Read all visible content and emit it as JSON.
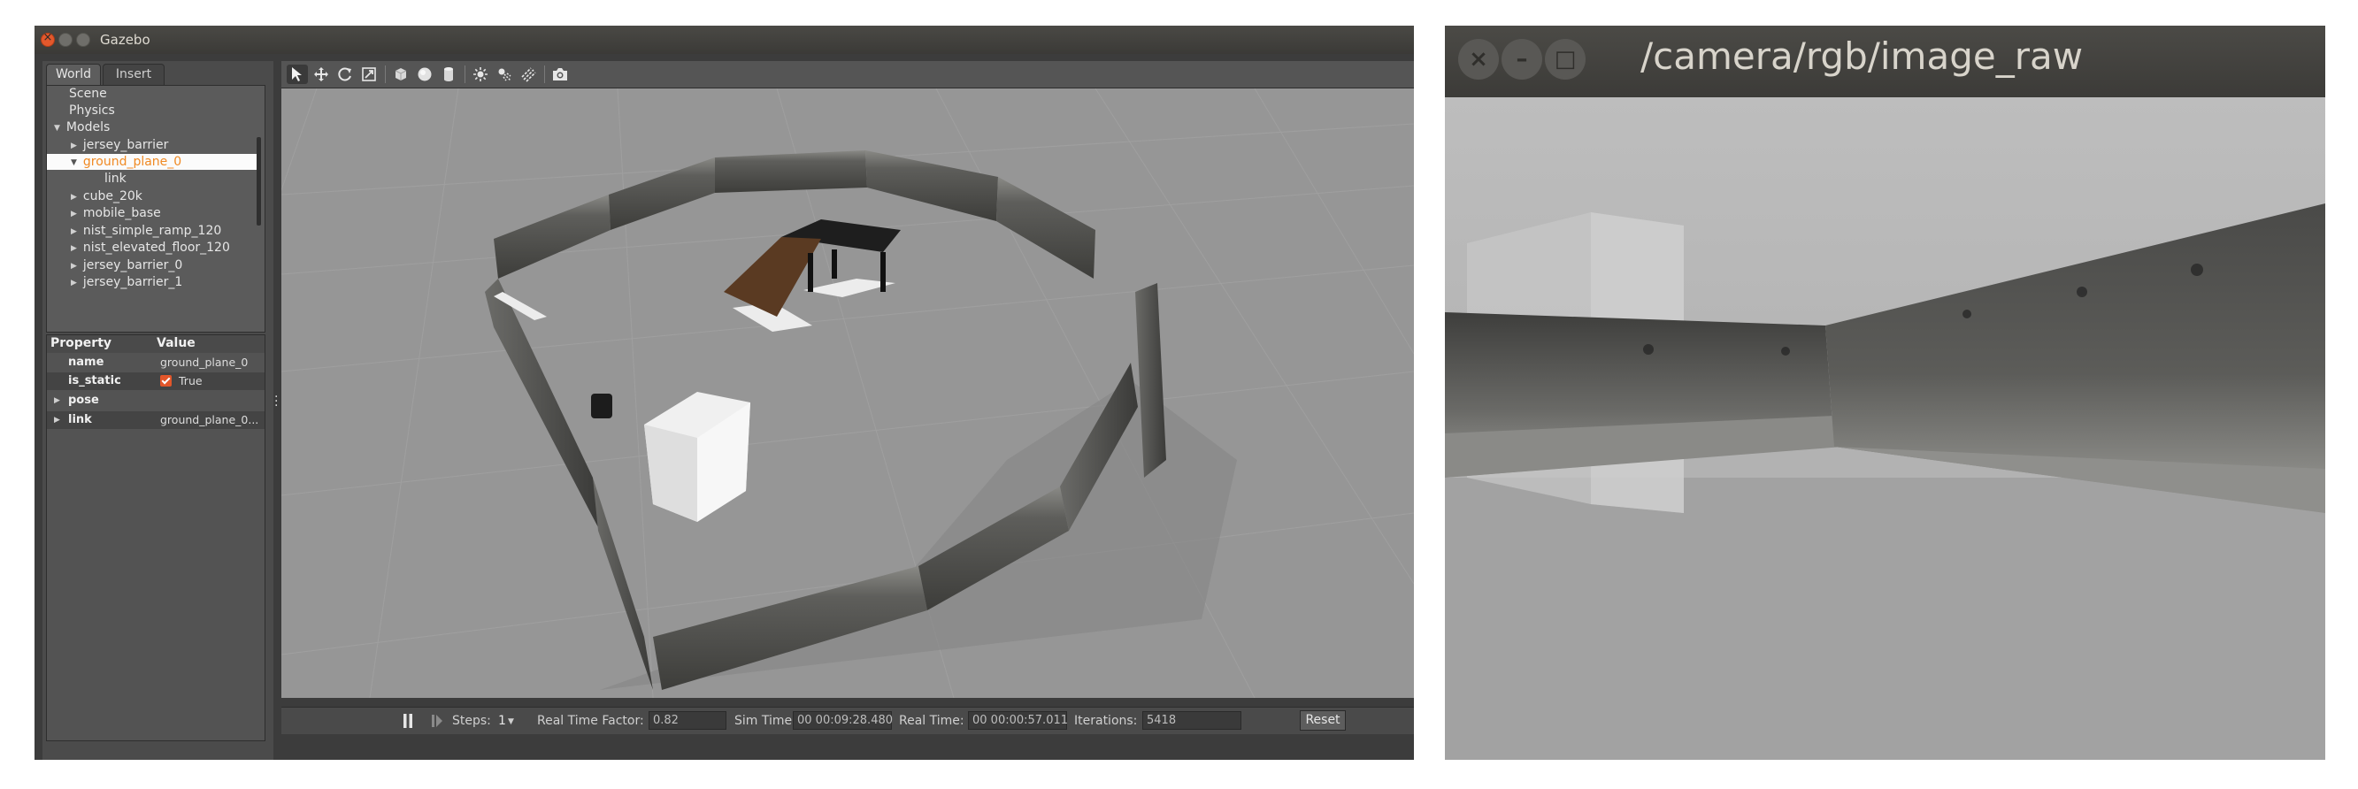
{
  "gazebo": {
    "window_title": "Gazebo",
    "close_glyph": "×",
    "tabs": {
      "world": "World",
      "insert": "Insert"
    },
    "tree": {
      "scene": "Scene",
      "physics": "Physics",
      "models": "Models",
      "models_children": [
        "jersey_barrier",
        "ground_plane_0",
        "link",
        "cube_20k",
        "mobile_base",
        "nist_simple_ramp_120",
        "nist_elevated_floor_120",
        "jersey_barrier_0",
        "jersey_barrier_1"
      ],
      "selected_item": "ground_plane_0"
    },
    "properties": {
      "header_property": "Property",
      "header_value": "Value",
      "rows": [
        {
          "key": "name",
          "value": "ground_plane_0"
        },
        {
          "key": "is_static",
          "value": "True"
        },
        {
          "key": "pose",
          "value": ""
        },
        {
          "key": "link",
          "value": "ground_plane_0..."
        }
      ]
    },
    "toolbar": {
      "tools": [
        "select-arrow-icon",
        "translate-icon",
        "rotate-icon",
        "scale-icon",
        "box-icon",
        "sphere-icon",
        "cylinder-icon",
        "point-light-icon",
        "spot-light-icon",
        "directional-light-icon",
        "screenshot-icon"
      ]
    },
    "status": {
      "steps_label": "Steps:",
      "steps_value": "1",
      "rtf_label": "Real Time Factor:",
      "rtf_value": "0.82",
      "sim_time_label": "Sim Time:",
      "sim_time_value": "00 00:09:28.480",
      "real_time_label": "Real Time:",
      "real_time_value": "00 00:00:57.011",
      "iterations_label": "Iterations:",
      "iterations_value": "5418",
      "reset_label": "Reset"
    }
  },
  "image_view": {
    "window_title": "/camera/rgb/image_raw",
    "close_glyph": "×",
    "min_glyph": "–",
    "max_glyph": "□"
  },
  "colors": {
    "title_bar": "#3f3e3b",
    "close_button": "#e3582c",
    "selection_text": "#f08a24",
    "viewport_ground": "#969696"
  }
}
